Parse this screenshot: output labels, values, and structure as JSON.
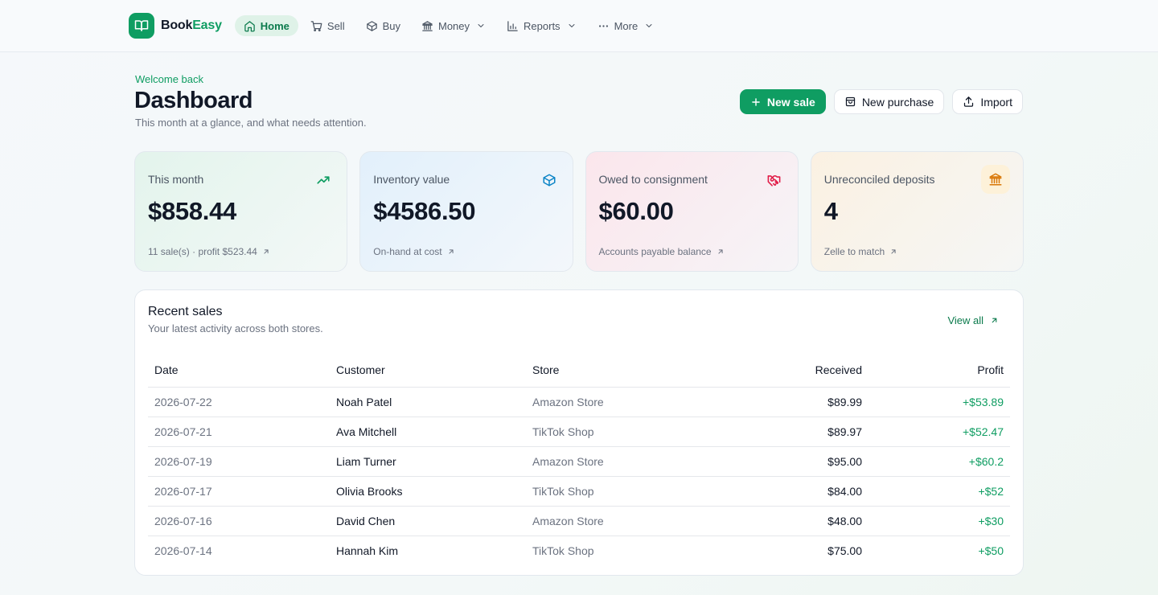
{
  "brand": {
    "name_part1": "Book",
    "name_part2": "Easy",
    "accent_color": "#0f9d62"
  },
  "nav": {
    "items": [
      {
        "label": "Home",
        "icon": "home-icon",
        "active": true
      },
      {
        "label": "Sell",
        "icon": "cart-icon"
      },
      {
        "label": "Buy",
        "icon": "box-icon"
      },
      {
        "label": "Money",
        "icon": "bank-icon",
        "dropdown": true
      },
      {
        "label": "Reports",
        "icon": "bar-chart-icon",
        "dropdown": true
      },
      {
        "label": "More",
        "icon": "more-dots-icon",
        "dropdown": true
      }
    ]
  },
  "header": {
    "welcome": "Welcome back",
    "title": "Dashboard",
    "subtitle": "This month at a glance, and what needs attention."
  },
  "actions": {
    "new_sale": "New sale",
    "new_purchase": "New purchase",
    "import": "Import"
  },
  "cards": [
    {
      "label": "This month",
      "value": "$858.44",
      "foot": "11 sale(s) · profit $523.44",
      "icon": "trending-up-icon",
      "color": "#0f9d62"
    },
    {
      "label": "Inventory value",
      "value": "$4586.50",
      "foot": "On-hand at cost",
      "icon": "package-icon",
      "color": "#0b84c6"
    },
    {
      "label": "Owed to consignment",
      "value": "$60.00",
      "foot": "Accounts payable balance",
      "icon": "handshake-icon",
      "color": "#e11d48"
    },
    {
      "label": "Unreconciled deposits",
      "value": "4",
      "foot": "Zelle to match",
      "icon": "bank-icon",
      "color": "#d97706"
    }
  ],
  "recent_sales": {
    "title": "Recent sales",
    "subtitle": "Your latest activity across both stores.",
    "view_all": "View all",
    "columns": {
      "date": "Date",
      "customer": "Customer",
      "store": "Store",
      "received": "Received",
      "profit": "Profit"
    },
    "rows": [
      {
        "date": "2026-07-22",
        "customer": "Noah Patel",
        "store": "Amazon Store",
        "received": "$89.99",
        "profit": "+$53.89"
      },
      {
        "date": "2026-07-21",
        "customer": "Ava Mitchell",
        "store": "TikTok Shop",
        "received": "$89.97",
        "profit": "+$52.47"
      },
      {
        "date": "2026-07-19",
        "customer": "Liam Turner",
        "store": "Amazon Store",
        "received": "$95.00",
        "profit": "+$60.2"
      },
      {
        "date": "2026-07-17",
        "customer": "Olivia Brooks",
        "store": "TikTok Shop",
        "received": "$84.00",
        "profit": "+$52"
      },
      {
        "date": "2026-07-16",
        "customer": "David Chen",
        "store": "Amazon Store",
        "received": "$48.00",
        "profit": "+$30"
      },
      {
        "date": "2026-07-14",
        "customer": "Hannah Kim",
        "store": "TikTok Shop",
        "received": "$75.00",
        "profit": "+$50"
      }
    ]
  }
}
